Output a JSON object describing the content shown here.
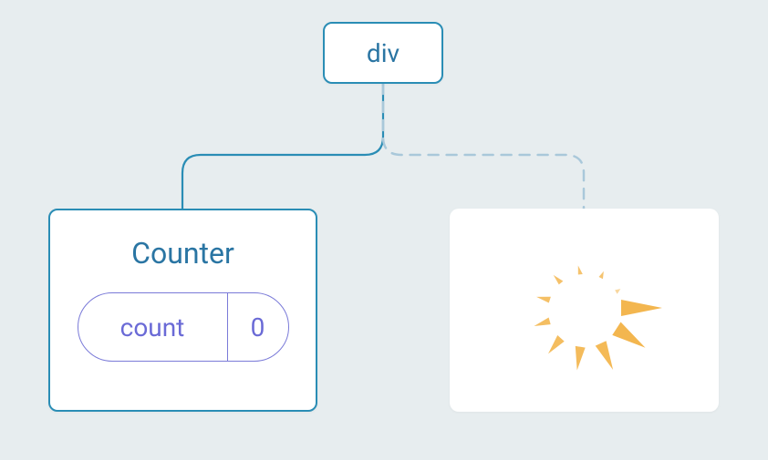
{
  "root": {
    "label": "div"
  },
  "counter": {
    "title": "Counter",
    "state_label": "count",
    "state_value": "0"
  },
  "colors": {
    "border": "#2a8db5",
    "text": "#2a75a3",
    "pill": "#7a7ad8",
    "pill_text": "#6a6ad6",
    "spinner": "#f2b040",
    "dashed": "#a9c8da"
  }
}
